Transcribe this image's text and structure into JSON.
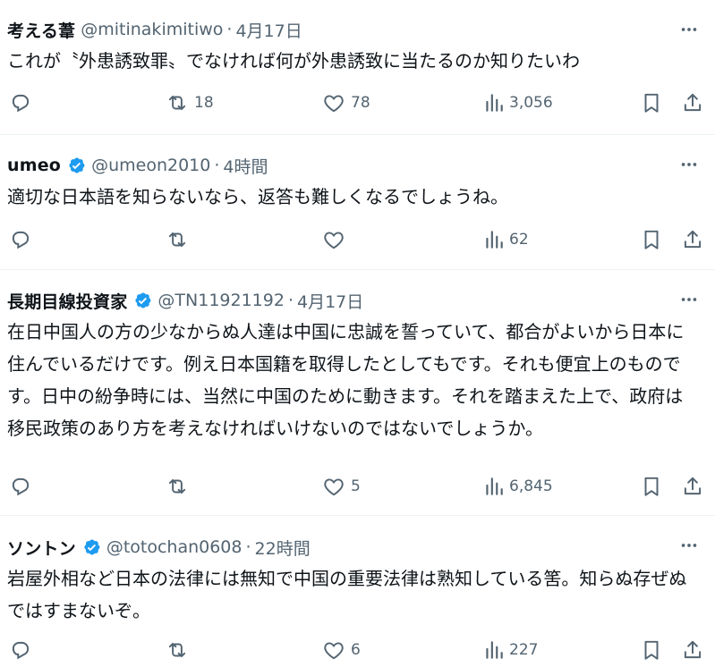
{
  "tweets": [
    {
      "name": "考える葦",
      "verified": false,
      "handle": "@mitinakimitiwo",
      "sep": "·",
      "time": "4月17日",
      "text": "これが〝外患誘致罪〟でなければ何が外患誘致に当たるのか知りたいわ",
      "replies": "",
      "retweets": "18",
      "likes": "78",
      "views": "3,056"
    },
    {
      "name": "umeo",
      "verified": true,
      "handle": "@umeon2010",
      "sep": "·",
      "time": "4時間",
      "text": "適切な日本語を知らないなら、返答も難しくなるでしょうね。",
      "replies": "",
      "retweets": "",
      "likes": "",
      "views": "62"
    },
    {
      "name": "長期目線投資家",
      "verified": true,
      "handle": "@TN11921192",
      "sep": "·",
      "time": "4月17日",
      "text": "在日中国人の方の少なからぬ人達は中国に忠誠を誓っていて、都合がよいから日本に住んでいるだけです。例え日本国籍を取得したとしてもです。それも便宜上のものです。日中の紛争時には、当然に中国のために動きます。それを踏まえた上で、政府は移民政策のあり方を考えなければいけないのではないでしょうか。",
      "replies": "",
      "retweets": "",
      "likes": "5",
      "views": "6,845"
    },
    {
      "name": "ソントン",
      "verified": true,
      "handle": "@totochan0608",
      "sep": "·",
      "time": "22時間",
      "text": "岩屋外相など日本の法律には無知で中国の重要法律は熟知している筈。知らぬ存ぜぬではすまないぞ。",
      "replies": "",
      "retweets": "",
      "likes": "6",
      "views": "227"
    }
  ],
  "icons": {
    "more": "more-icon",
    "reply": "reply-icon",
    "retweet": "retweet-icon",
    "like": "like-icon",
    "views": "views-icon",
    "bookmark": "bookmark-icon",
    "share": "share-icon",
    "verified": "verified-badge-icon"
  },
  "colors": {
    "text": "#0f1419",
    "muted": "#536471",
    "verified": "#1d9bf0",
    "divider": "#eff3f4"
  }
}
